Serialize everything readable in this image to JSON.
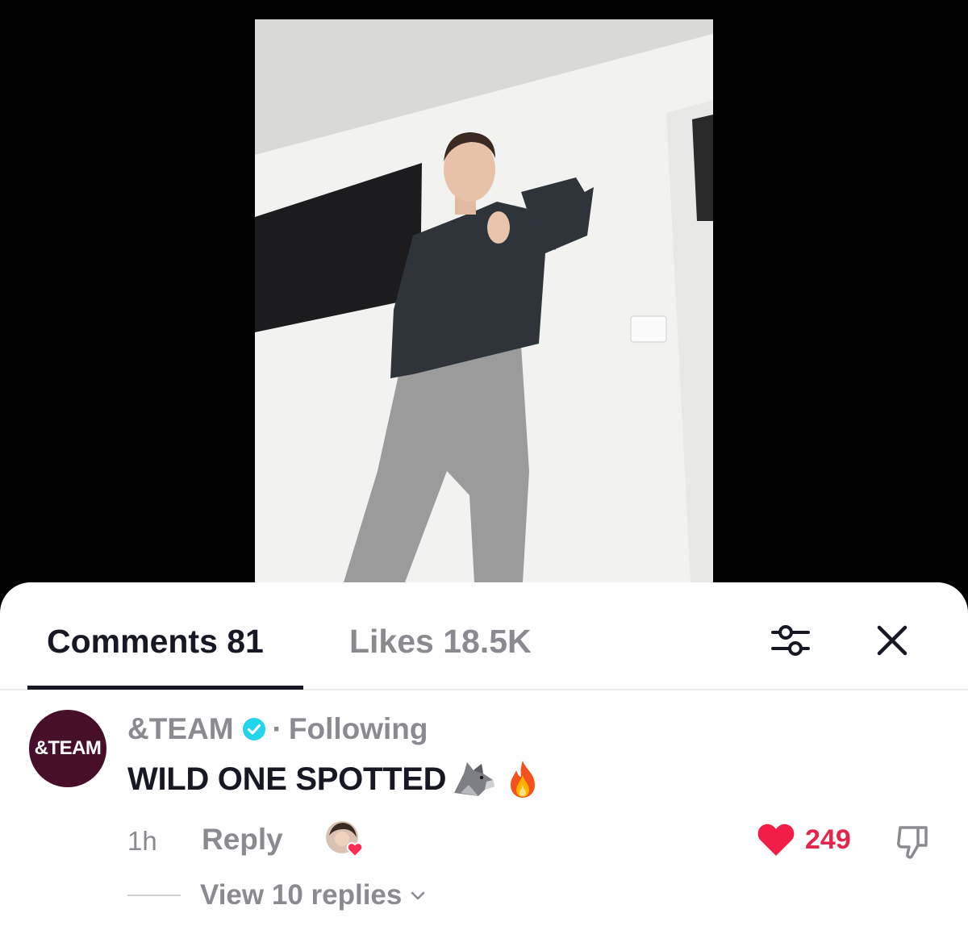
{
  "tabs": {
    "comments_label": "Comments 81",
    "likes_label": "Likes 18.5K"
  },
  "icons": {
    "filter": "sliders-icon",
    "close": "close-icon",
    "verified": "verified-badge-icon",
    "like": "heart-icon",
    "dislike": "thumbs-down-icon",
    "expand": "chevron-down-icon"
  },
  "comment": {
    "avatar_text": "&TEAM",
    "username": "&TEAM",
    "separator": "·",
    "follow_status": "Following",
    "text": "WILD ONE SPOTTED",
    "emojis": [
      "wolf",
      "fire"
    ],
    "time": "1h",
    "reply_label": "Reply",
    "like_count": "249",
    "view_replies_label": "View 10 replies"
  },
  "colors": {
    "avatar_bg": "#480f2a",
    "like_red": "#e3264a",
    "verified_blue": "#20d5ec",
    "muted_text": "#8a8b91",
    "primary_text": "#161823"
  }
}
